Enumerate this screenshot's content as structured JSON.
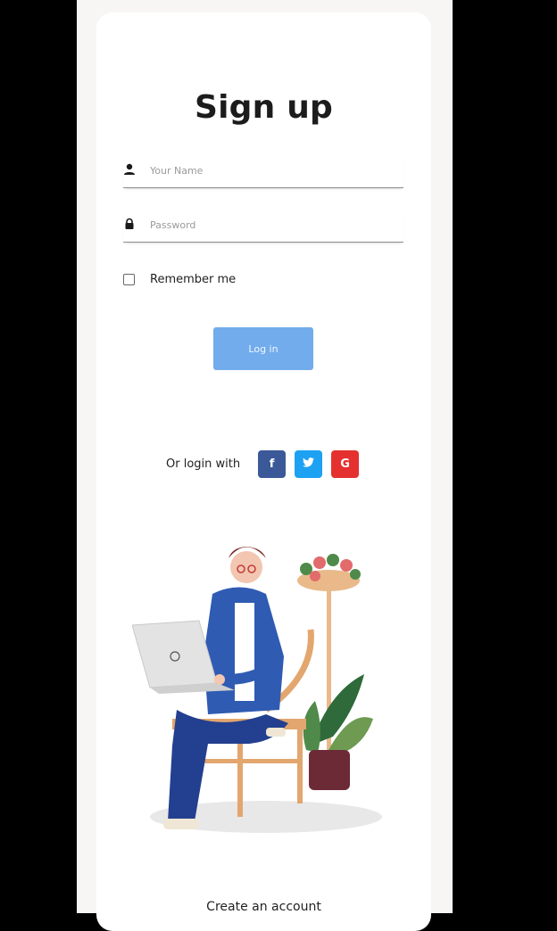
{
  "title": "Sign up",
  "fields": {
    "name": {
      "placeholder": "Your Name",
      "icon": "user-icon"
    },
    "password": {
      "placeholder": "Password",
      "icon": "lock-icon"
    }
  },
  "remember": {
    "label": "Remember me",
    "checked": false
  },
  "login_button": {
    "label": "Log in"
  },
  "social": {
    "label": "Or login with",
    "providers": [
      {
        "name": "facebook",
        "glyph": "f",
        "color": "#3b5998",
        "icon": "facebook-icon"
      },
      {
        "name": "twitter",
        "glyph": "t",
        "color": "#1da1f2",
        "icon": "twitter-icon"
      },
      {
        "name": "google",
        "glyph": "G",
        "color": "#e4312f",
        "icon": "google-icon"
      }
    ]
  },
  "create_account": "Create an account",
  "colors": {
    "accent": "#72acec",
    "background": "#f7f6f4"
  }
}
